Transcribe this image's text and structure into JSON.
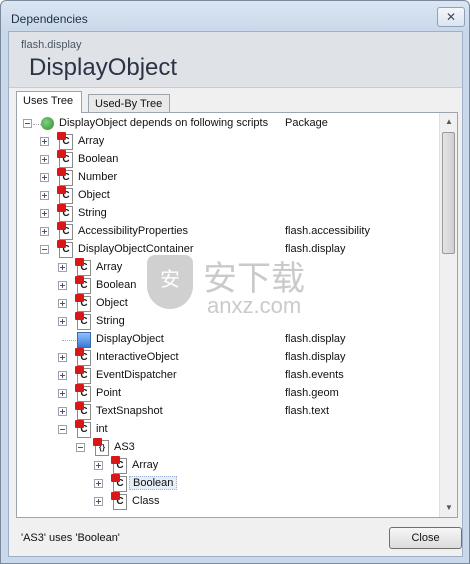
{
  "window": {
    "title": "Dependencies",
    "close_glyph": "✕"
  },
  "header": {
    "package": "flash.display",
    "class_name": "DisplayObject"
  },
  "tabs": [
    {
      "label": "Uses Tree",
      "active": true
    },
    {
      "label": "Used-By Tree",
      "active": false
    }
  ],
  "tree": {
    "root_label": "DisplayObject depends on following scripts",
    "package_header": "Package",
    "rows": [
      {
        "label": "Array",
        "package": "",
        "icon": "class-icon"
      },
      {
        "label": "Boolean",
        "package": "",
        "icon": "class-icon"
      },
      {
        "label": "Number",
        "package": "",
        "icon": "class-icon"
      },
      {
        "label": "Object",
        "package": "",
        "icon": "class-icon"
      },
      {
        "label": "String",
        "package": "",
        "icon": "class-icon"
      },
      {
        "label": "AccessibilityProperties",
        "package": "flash.accessibility",
        "icon": "class-icon"
      },
      {
        "label": "DisplayObjectContainer",
        "package": "flash.display",
        "icon": "class-icon"
      },
      {
        "label": "Array",
        "package": "",
        "icon": "class-icon"
      },
      {
        "label": "Boolean",
        "package": "",
        "icon": "class-icon"
      },
      {
        "label": "Object",
        "package": "",
        "icon": "class-icon"
      },
      {
        "label": "String",
        "package": "",
        "icon": "class-icon"
      },
      {
        "label": "DisplayObject",
        "package": "flash.display",
        "icon": "display-object-icon"
      },
      {
        "label": "InteractiveObject",
        "package": "flash.display",
        "icon": "class-icon"
      },
      {
        "label": "EventDispatcher",
        "package": "flash.events",
        "icon": "class-icon"
      },
      {
        "label": "Point",
        "package": "flash.geom",
        "icon": "class-icon"
      },
      {
        "label": "TextSnapshot",
        "package": "flash.text",
        "icon": "class-icon"
      },
      {
        "label": "int",
        "package": "",
        "icon": "class-icon"
      },
      {
        "label": "AS3",
        "package": "",
        "icon": "namespace-icon"
      },
      {
        "label": "Array",
        "package": "",
        "icon": "class-icon"
      },
      {
        "label": "Boolean",
        "package": "",
        "icon": "class-icon"
      },
      {
        "label": "Class",
        "package": "",
        "icon": "class-icon"
      }
    ]
  },
  "watermark": {
    "main": "安下载",
    "sub": "anxz.com",
    "shield": "安"
  },
  "status_text": "'AS3' uses 'Boolean'",
  "close_button_label": "Close",
  "colors": {
    "class_icon_red": "#d81818",
    "title_bar": "#c9d8ea"
  }
}
